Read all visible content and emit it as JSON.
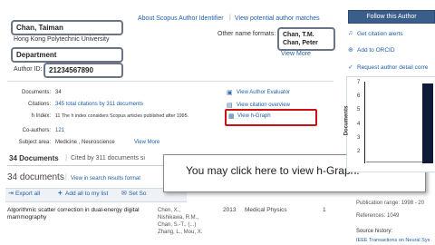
{
  "profile": {
    "name": "Chan, Taiman",
    "affiliation": "Hong Kong Polytechnic University",
    "department": "Department",
    "author_id_label": "Author ID:",
    "author_id": "21234567890"
  },
  "top_links": {
    "about": "About Scopus Author Identifier",
    "potential": "View potential author matches"
  },
  "other_names": {
    "label": "Other name formats:",
    "names": [
      "Chan, T.M.",
      "Chan, Peter"
    ],
    "view_more": "View More"
  },
  "metrics": {
    "documents_label": "Documents:",
    "documents_value": "34",
    "citations_label": "Citations:",
    "citations_value": "345 total citations by 311 documents",
    "hindex_label": "h Index:",
    "hindex_value": "11  The h index considers Scopus articles published after 1995.",
    "coauthors_label": "Co-authors:",
    "coauthors_value": "121",
    "subject_label": "Subject area:",
    "subject_value": "Medicine ,  Neuroscience",
    "subject_more": "View More"
  },
  "side_links": {
    "evaluator": "View Author Evaluator",
    "citation_overview": "View citation overview",
    "hgraph": "View h-Graph"
  },
  "tabs": {
    "documents": "34 Documents",
    "cited_by": "Cited by 311 documents si"
  },
  "results": {
    "heading": "34 documents",
    "search_format": "View in search results format",
    "export": "Export all",
    "add_list": "Add all to my list",
    "set_alert": "Set So"
  },
  "tooltip": "You may click here to view h-Graph.",
  "document_row": {
    "title": "Algorithmic scatter correction in dual-energy digital mammography",
    "authors": [
      "Chen, X.,",
      "Nishikawa, R.M.,",
      "Chan, S.-T., (...)",
      "Zhang, L., Mou, X."
    ],
    "year": "2013",
    "source": "Medical Physics",
    "cited": "1"
  },
  "right_panel": {
    "follow": "Follow this Author",
    "citation_alerts": "Get citation alerts",
    "orcid": "Add to ORCID",
    "request": "Request author detail corre",
    "chart_ylabel": "Documents",
    "pub_range": "Publication range: 1998 - 20",
    "references": "References: 1049",
    "source_history_label": "Source history:",
    "source_history_link": "IEEE Transactions on Neural Sys"
  },
  "chart_data": {
    "type": "bar",
    "ylabel": "Documents",
    "yticks": [
      "7",
      "6",
      "5",
      "4",
      "3",
      "2"
    ],
    "ylim": [
      0,
      7
    ]
  }
}
